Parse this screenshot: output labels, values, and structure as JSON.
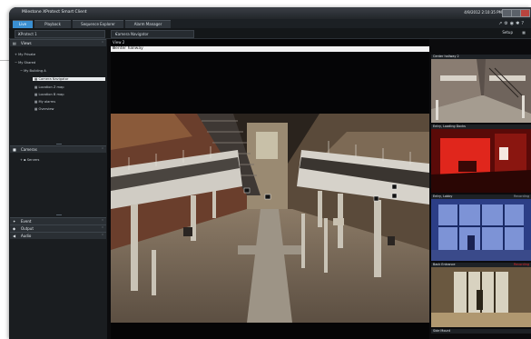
{
  "window": {
    "title": "Milestone XProtect Smart Client",
    "clock": "4/9/2012 2:10:35 PM"
  },
  "tabs": [
    {
      "label": "Live",
      "active": true
    },
    {
      "label": "Playback",
      "active": false
    },
    {
      "label": "Sequence Explorer",
      "active": false
    },
    {
      "label": "Alarm Manager",
      "active": false
    }
  ],
  "toolbar": {
    "view_select": "XProtect 1",
    "camera_select": "Camera Navigator",
    "setup_label": "Setup"
  },
  "sidebar": {
    "views_header": "Views",
    "tree": [
      "My Private",
      "My Shared",
      "My Building A",
      "Camera Navigator",
      "Location Z map",
      "Location B map",
      "My alarms",
      "Overview"
    ],
    "cameras_header": "Cameras",
    "cameras_tree": [
      "Servers"
    ],
    "event_header": "Event",
    "output_header": "Output",
    "audio_header": "Audio"
  },
  "main": {
    "view_name": "View 2",
    "camera_title": "Center hallway"
  },
  "thumbnails": [
    {
      "title": "Center hallway 2",
      "status": ""
    },
    {
      "title": "Entry, Loading Docks"
    },
    {
      "title": "Entry, Lobby",
      "status": "Recording"
    },
    {
      "title": "Back Entrance",
      "status": "Recording"
    },
    {
      "title": "Side Mount"
    }
  ],
  "colors": {
    "accent": "#3a8fd1",
    "recording": "#e0262d",
    "window_bg": "#0b0b0d"
  },
  "icons": [
    "views-icon",
    "cameras-icon",
    "event-icon",
    "output-icon",
    "audio-icon",
    "grid-icon"
  ]
}
